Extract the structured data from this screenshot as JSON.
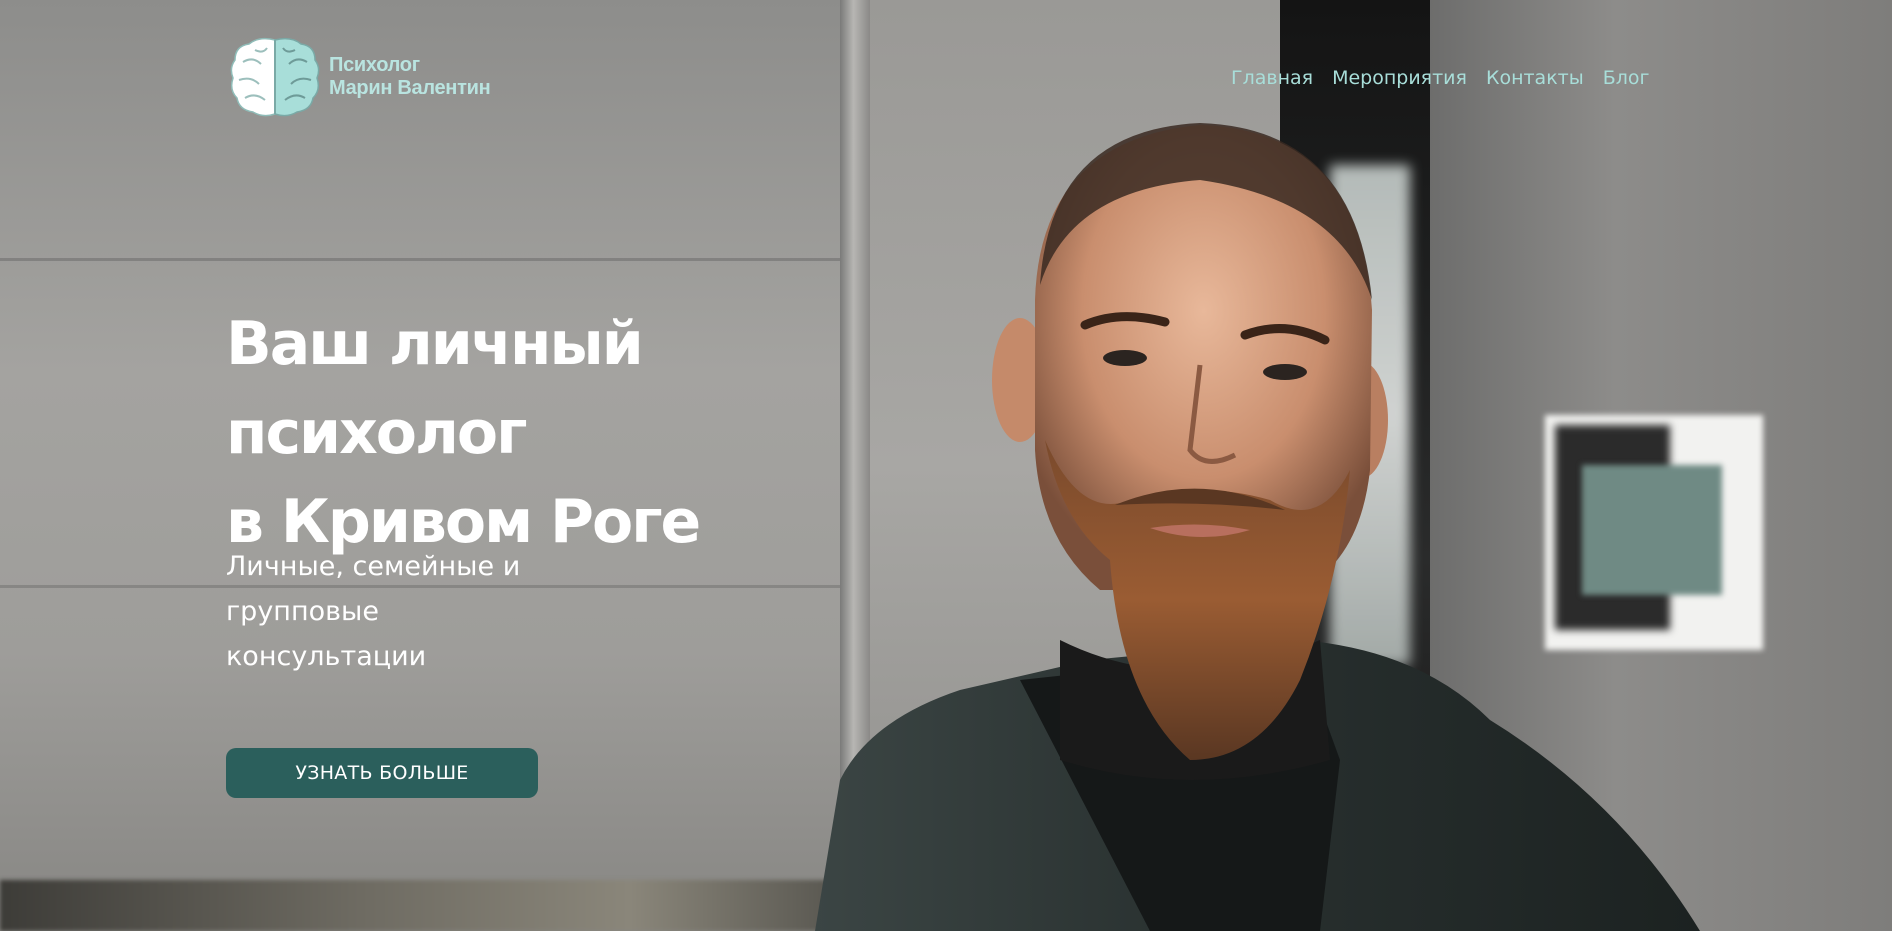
{
  "site": {
    "logo": {
      "line1": "Психолог",
      "line2": "Марин Валентин",
      "icon": "brain-icon",
      "colors": {
        "left": "#ffffff",
        "right": "#a8ded9",
        "outline": "#7aa9a6"
      }
    },
    "nav": {
      "items": [
        {
          "label": "Главная"
        },
        {
          "label": "Мероприятия"
        },
        {
          "label": "Контакты"
        },
        {
          "label": "Блог"
        }
      ]
    }
  },
  "hero": {
    "title_line1": "Ваш личный психолог",
    "title_line2": "в Кривом Роге",
    "subtitle_line1": "Личные, семейные и",
    "subtitle_line2": "групповые",
    "subtitle_line3": "консультации",
    "cta_label": "УЗНАТЬ БОЛЬШЕ",
    "background_image": "portrait of bearded man in dark jacket"
  },
  "colors": {
    "accent": "#2b5f5c",
    "nav_text": "#a8ded9",
    "title_text": "#ffffff"
  }
}
